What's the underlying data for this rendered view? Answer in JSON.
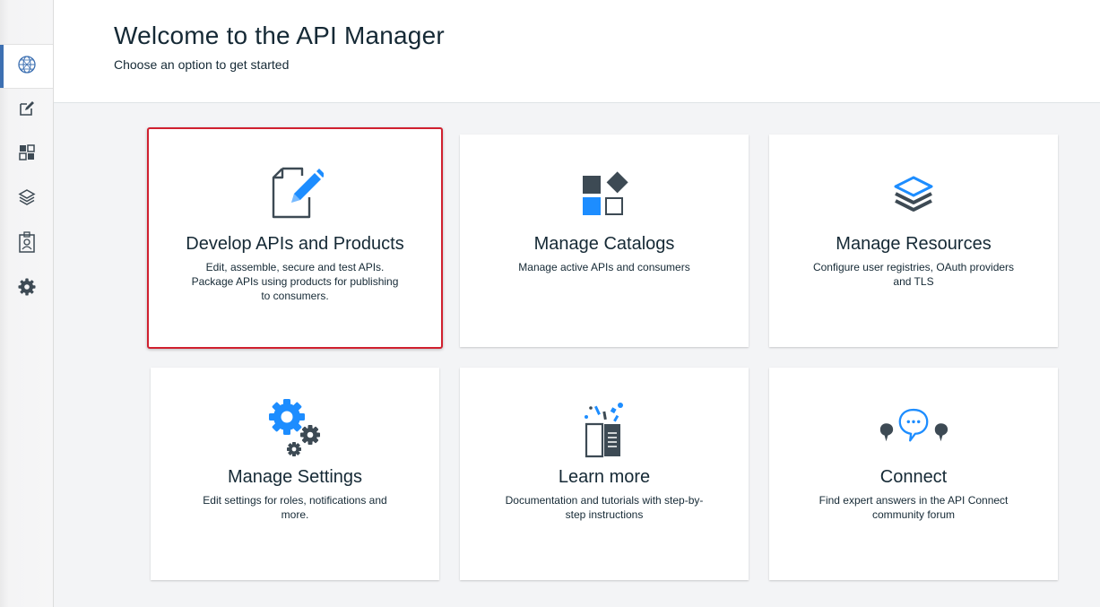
{
  "header": {
    "title": "Welcome to the API Manager",
    "subtitle": "Choose an option to get started"
  },
  "sidebar": {
    "items": [
      {
        "name": "dashboard",
        "icon": "globe-icon",
        "active": true
      },
      {
        "name": "develop",
        "icon": "edit-document-icon",
        "active": false
      },
      {
        "name": "catalogs",
        "icon": "catalog-icon",
        "active": false
      },
      {
        "name": "resources",
        "icon": "layers-icon",
        "active": false
      },
      {
        "name": "members",
        "icon": "id-badge-icon",
        "active": false
      },
      {
        "name": "settings",
        "icon": "gear-icon",
        "active": false
      }
    ]
  },
  "tiles": [
    {
      "title": "Develop APIs and Products",
      "description": "Edit, assemble, secure and test APIs. Package APIs using products for publishing to consumers.",
      "icon": "document-pencil-icon",
      "selected": true
    },
    {
      "title": "Manage Catalogs",
      "description": "Manage active APIs and consumers",
      "icon": "catalog-blocks-icon",
      "selected": false
    },
    {
      "title": "Manage Resources",
      "description": "Configure user registries, OAuth providers and TLS",
      "icon": "layers-stack-icon",
      "selected": false
    },
    {
      "title": "Manage Settings",
      "description": "Edit settings for roles, notifications and more.",
      "icon": "gears-icon",
      "selected": false
    },
    {
      "title": "Learn more",
      "description": "Documentation and tutorials with step-by-step instructions",
      "icon": "open-book-icon",
      "selected": false
    },
    {
      "title": "Connect",
      "description": "Find expert answers in the API Connect community forum",
      "icon": "chat-bubbles-icon",
      "selected": false
    }
  ],
  "colors": {
    "accent_blue": "#1d8dff",
    "icon_dark": "#3d4a54",
    "selection_red": "#d0202f",
    "sidebar_active": "#3d70b2"
  }
}
